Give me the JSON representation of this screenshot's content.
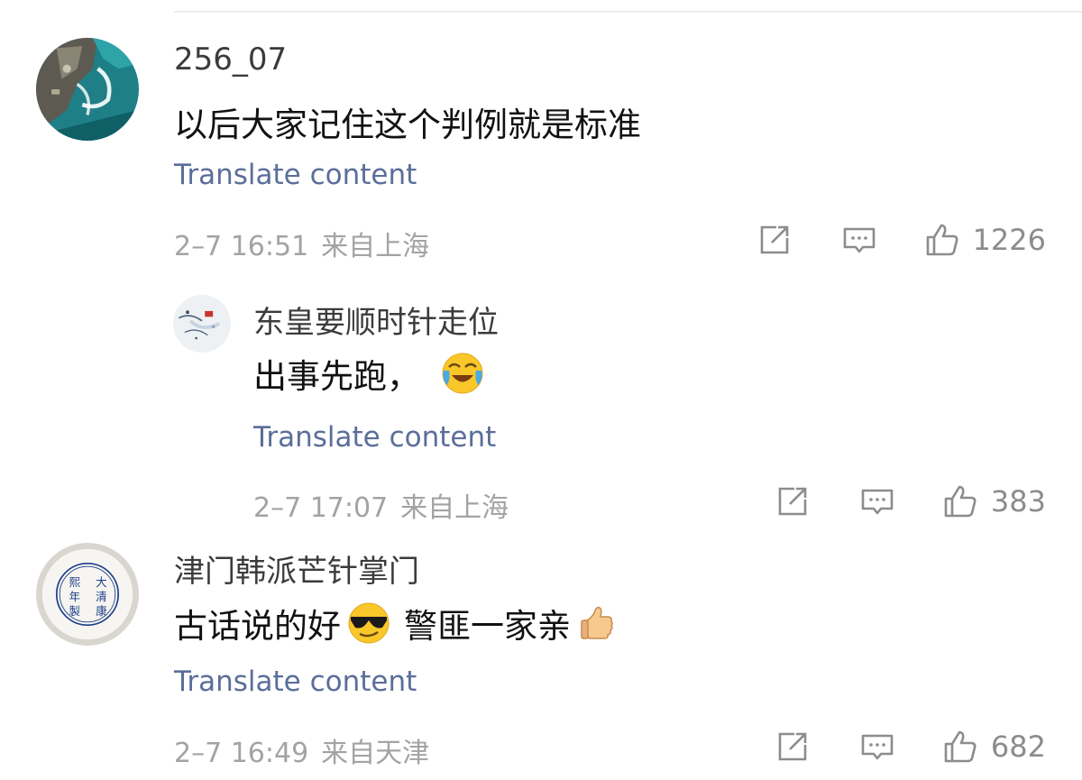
{
  "comments": [
    {
      "username": "256_07",
      "text": "以后大家记住这个判例就是标准",
      "translate_label": "Translate content",
      "time": "2–7 16:51",
      "location": "来自上海",
      "like_count": "1226"
    },
    {
      "username": "东皇要顺时针走位",
      "text": "出事先跑，",
      "translate_label": "Translate content",
      "time": "2–7 17:07",
      "location": "来自上海",
      "like_count": "383"
    },
    {
      "username": "津门韩派芒针掌门",
      "text_before": "古话说的好",
      "text_after": "警匪一家亲",
      "translate_label": "Translate content",
      "time": "2–7 16:49",
      "location": "来自天津",
      "like_count": "682"
    }
  ],
  "avatar3_seal_text": "大清康熙年製",
  "colors": {
    "link": "#5b6e9a",
    "meta": "#a3a3a3",
    "icon": "#8c8c8c"
  }
}
